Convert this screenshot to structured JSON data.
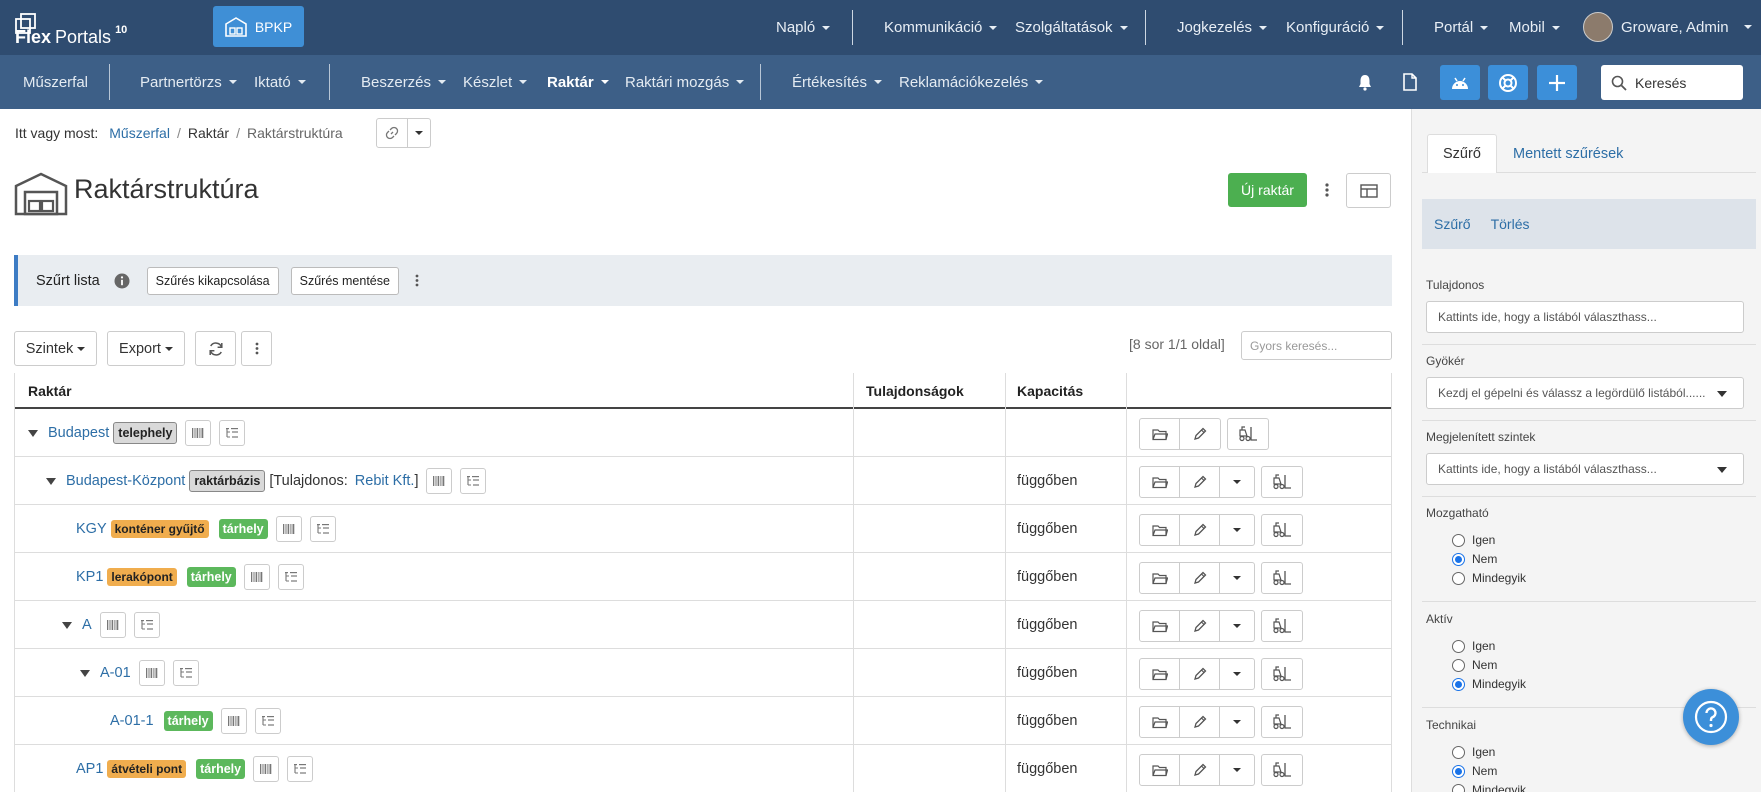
{
  "brand": {
    "name_bold": "Flex",
    "name_rest": "Portals",
    "version": "10"
  },
  "bpkp_label": "BPKP",
  "topnav": [
    "Napló",
    "Kommunikáció",
    "Szolgáltatások",
    "Jogkezelés",
    "Konfiguráció",
    "Portál",
    "Mobil"
  ],
  "user": "Groware, Admin",
  "subnav": [
    "Műszerfal",
    "Partnertörzs",
    "Iktató",
    "Beszerzés",
    "Készlet",
    "Raktár",
    "Raktári mozgás",
    "Értékesítés",
    "Reklamációkezelés"
  ],
  "search_placeholder": "Keresés",
  "breadcrumb": {
    "prefix": "Itt vagy most:",
    "items": [
      "Műszerfal",
      "Raktár",
      "Raktárstruktúra"
    ]
  },
  "page_title": "Raktárstruktúra",
  "new_button": "Új raktár",
  "filter_strip": {
    "label": "Szűrt lista",
    "disable": "Szűrés kikapcsolása",
    "save": "Szűrés mentése"
  },
  "toolbar": {
    "levels": "Szintek",
    "export": "Export"
  },
  "page_info": "[8 sor 1/1 oldal]",
  "quick_search_placeholder": "Gyors keresés...",
  "columns": {
    "warehouse": "Raktár",
    "properties": "Tulajdonságok",
    "capacity": "Kapacitás"
  },
  "rows": [
    {
      "name": "Budapest",
      "badge": "telephely",
      "capacity": ""
    },
    {
      "name": "Budapest-Központ",
      "badge": "raktárbázis",
      "owner_prefix": "[Tulajdonos:",
      "owner": "Rebit Kft.",
      "owner_suffix": "]",
      "capacity": "függőben"
    },
    {
      "name": "KGY",
      "tag": "konténer gyűjtő",
      "badge": "tárhely",
      "capacity": "függőben"
    },
    {
      "name": "KP1",
      "tag": "lerakópont",
      "badge": "tárhely",
      "capacity": "függőben"
    },
    {
      "name": "A",
      "capacity": "függőben"
    },
    {
      "name": "A-01",
      "capacity": "függőben"
    },
    {
      "name": "A-01-1",
      "badge": "tárhely",
      "capacity": "függőben"
    },
    {
      "name": "AP1",
      "tag": "átvételi pont",
      "badge": "tárhely",
      "capacity": "függőben"
    }
  ],
  "side": {
    "tabs": [
      "Szűrő",
      "Mentett szűrések"
    ],
    "actions": [
      "Szűrő",
      "Törlés"
    ],
    "owner": {
      "label": "Tulajdonos",
      "placeholder": "Kattints ide, hogy a listából választhass..."
    },
    "root": {
      "label": "Gyökér",
      "placeholder": "Kezdj el gépelni és válassz a legördülő listából......"
    },
    "levels": {
      "label": "Megjelenített szintek",
      "placeholder": "Kattints ide, hogy a listából választhass..."
    },
    "movable": {
      "label": "Mozgatható",
      "options": [
        "Igen",
        "Nem",
        "Mindegyik"
      ],
      "selected": 1
    },
    "active": {
      "label": "Aktív",
      "options": [
        "Igen",
        "Nem",
        "Mindegyik"
      ],
      "selected": 2
    },
    "technical": {
      "label": "Technikai",
      "options": [
        "Igen",
        "Nem",
        "Mindegyik"
      ],
      "selected": 1
    }
  },
  "colors": {
    "topbar": "#2f4c70",
    "subbar": "#3d5f87",
    "primary": "#3c8fd9",
    "success": "#4caf50",
    "warning": "#f0ad4e"
  }
}
